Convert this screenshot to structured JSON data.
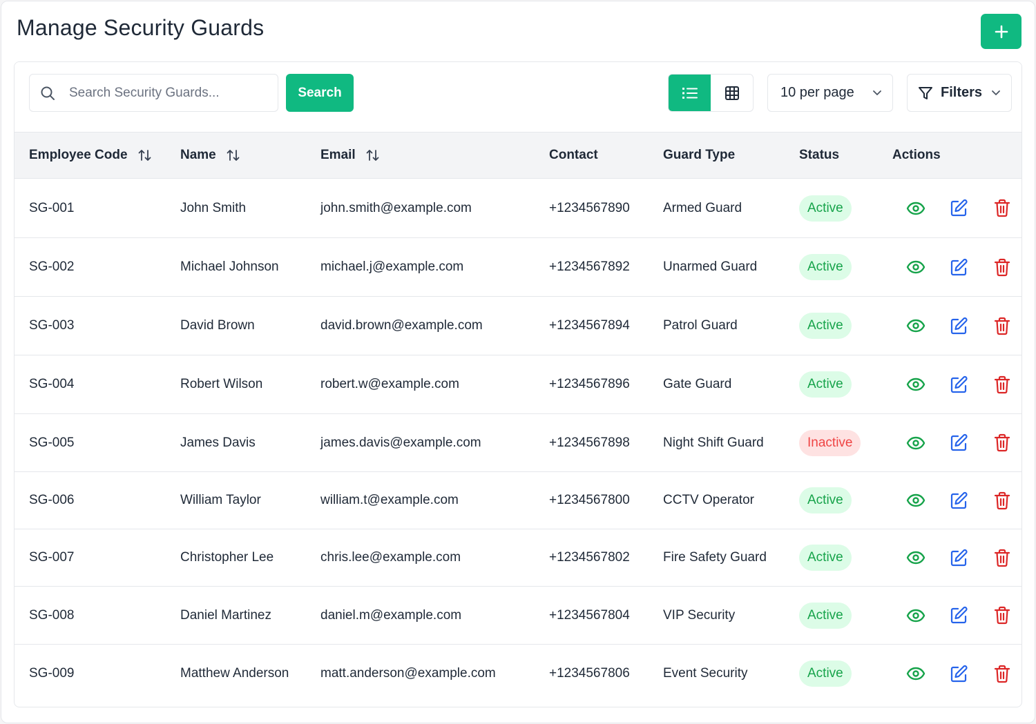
{
  "page": {
    "title": "Manage Security Guards",
    "add_button_icon": "plus-icon"
  },
  "toolbar": {
    "search_placeholder": "Search Security Guards...",
    "search_button_label": "Search",
    "view_modes": [
      "list-icon",
      "grid-icon"
    ],
    "active_view": "list",
    "per_page_label": "10 per page",
    "filters_label": "Filters"
  },
  "table": {
    "columns": [
      {
        "label": "Employee Code",
        "sortable": true
      },
      {
        "label": "Name",
        "sortable": true
      },
      {
        "label": "Email",
        "sortable": true
      },
      {
        "label": "Contact",
        "sortable": false
      },
      {
        "label": "Guard Type",
        "sortable": false
      },
      {
        "label": "Status",
        "sortable": false
      },
      {
        "label": "Actions",
        "sortable": false
      }
    ],
    "rows": [
      {
        "code": "SG-001",
        "name": "John Smith",
        "email": "john.smith@example.com",
        "contact": "+1234567890",
        "type": "Armed Guard",
        "status": "Active"
      },
      {
        "code": "SG-002",
        "name": "Michael Johnson",
        "email": "michael.j@example.com",
        "contact": "+1234567892",
        "type": "Unarmed Guard",
        "status": "Active"
      },
      {
        "code": "SG-003",
        "name": "David Brown",
        "email": "david.brown@example.com",
        "contact": "+1234567894",
        "type": "Patrol Guard",
        "status": "Active"
      },
      {
        "code": "SG-004",
        "name": "Robert Wilson",
        "email": "robert.w@example.com",
        "contact": "+1234567896",
        "type": "Gate Guard",
        "status": "Active"
      },
      {
        "code": "SG-005",
        "name": "James Davis",
        "email": "james.davis@example.com",
        "contact": "+1234567898",
        "type": "Night Shift Guard",
        "status": "Inactive"
      },
      {
        "code": "SG-006",
        "name": "William Taylor",
        "email": "william.t@example.com",
        "contact": "+1234567800",
        "type": "CCTV Operator",
        "status": "Active"
      },
      {
        "code": "SG-007",
        "name": "Christopher Lee",
        "email": "chris.lee@example.com",
        "contact": "+1234567802",
        "type": "Fire Safety Guard",
        "status": "Active"
      },
      {
        "code": "SG-008",
        "name": "Daniel Martinez",
        "email": "daniel.m@example.com",
        "contact": "+1234567804",
        "type": "VIP Security",
        "status": "Active"
      },
      {
        "code": "SG-009",
        "name": "Matthew Anderson",
        "email": "matt.anderson@example.com",
        "contact": "+1234567806",
        "type": "Event Security",
        "status": "Active"
      }
    ],
    "row_actions": [
      "eye-icon",
      "edit-icon",
      "trash-icon"
    ]
  },
  "colors": {
    "accent": "#10b981",
    "active_badge_bg": "#dcfce7",
    "active_badge_text": "#16a34a",
    "inactive_badge_bg": "#fee2e2",
    "inactive_badge_text": "#ef4444",
    "view_icon": "#16a34a",
    "edit_icon": "#2563eb",
    "delete_icon": "#dc2626"
  }
}
